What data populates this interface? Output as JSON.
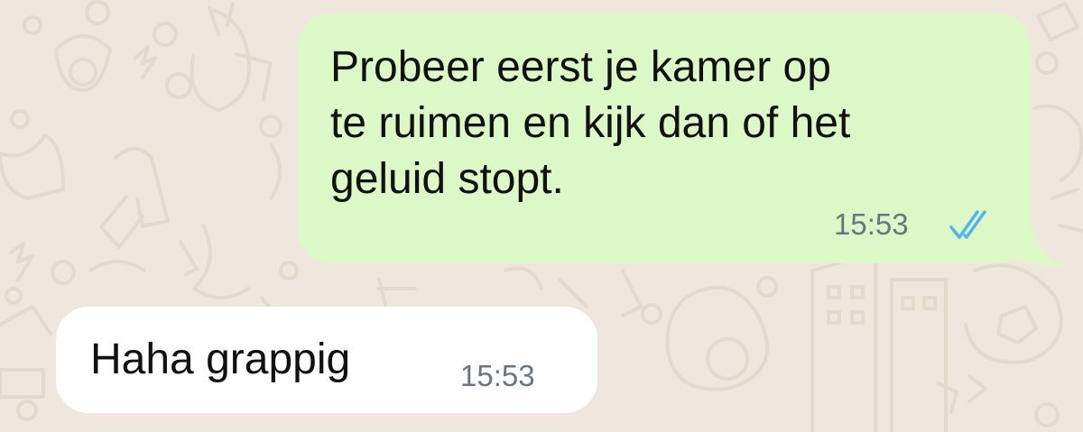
{
  "messages": [
    {
      "direction": "outgoing",
      "text": "Probeer eerst je kamer op\nte ruimen en kijk dan of het\ngeluid stopt.",
      "time": "15:53",
      "status_icon": "double-check-read-icon",
      "bubble_color": "#dcf8c6"
    },
    {
      "direction": "incoming",
      "text": "Haha grappig",
      "time": "15:53",
      "bubble_color": "#ffffff"
    }
  ],
  "colors": {
    "background": "#efe7dd",
    "text": "#111111",
    "timestamp": "#667781",
    "read_ticks": "#4fb6ec"
  }
}
